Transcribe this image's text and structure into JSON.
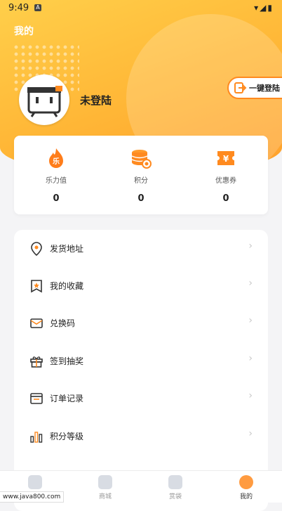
{
  "status": {
    "time": "9:49",
    "sys_icons": "▾◢▮"
  },
  "header": {
    "title": "我的"
  },
  "profile": {
    "username": "未登陆",
    "login_button": "一键登陆"
  },
  "stats": [
    {
      "label": "乐力值",
      "value": "0",
      "icon": "fire-icon",
      "glyph": "乐"
    },
    {
      "label": "积分",
      "value": "0",
      "icon": "coins-icon"
    },
    {
      "label": "优惠券",
      "value": "0",
      "icon": "coupon-icon",
      "glyph": "¥"
    }
  ],
  "menu": [
    {
      "label": "发货地址",
      "icon": "location-icon"
    },
    {
      "label": "我的收藏",
      "icon": "bookmark-icon"
    },
    {
      "label": "兑换码",
      "icon": "envelope-icon"
    },
    {
      "label": "签到抽奖",
      "icon": "gift-icon"
    },
    {
      "label": "订单记录",
      "icon": "order-icon"
    },
    {
      "label": "积分等级",
      "icon": "bars-icon"
    }
  ],
  "tabs": [
    {
      "label": "",
      "icon": "home-icon",
      "active": false
    },
    {
      "label": "商城",
      "icon": "shop-icon",
      "active": false
    },
    {
      "label": "赏袋",
      "icon": "bag-icon",
      "active": false
    },
    {
      "label": "我的",
      "icon": "profile-icon",
      "active": true
    }
  ],
  "watermark": "www.java800.com",
  "colors": {
    "accent": "#ff8a1f",
    "hero_top": "#ffcf4a",
    "hero_bottom": "#ff9f2c"
  }
}
